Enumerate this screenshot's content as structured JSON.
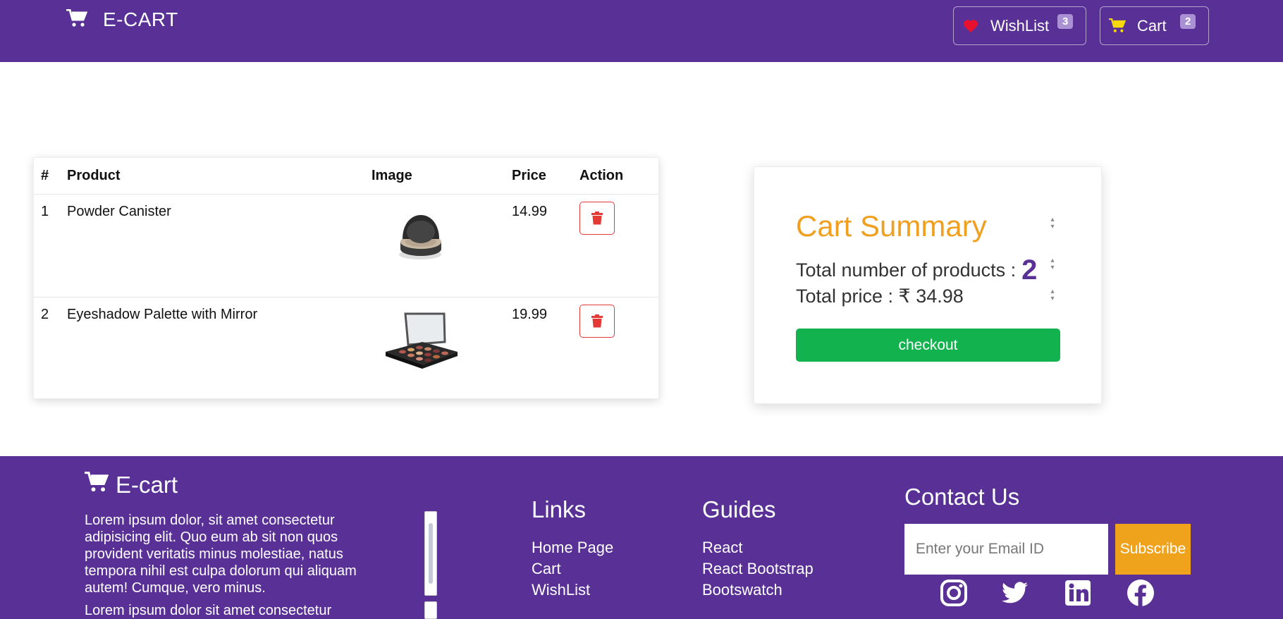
{
  "navbar": {
    "brand": "E-CART",
    "brand_icon": "cart-icon",
    "wishlist": {
      "label": "WishList",
      "count": "3",
      "icon": "heart-icon",
      "icon_color": "#e8112d"
    },
    "cart": {
      "label": "Cart",
      "count": "2",
      "icon": "cart-icon",
      "icon_color": "#f5d90a"
    },
    "background": "#593196"
  },
  "cart_table": {
    "headers": [
      "#",
      "Product",
      "Image",
      "Price",
      "Action"
    ],
    "rows": [
      {
        "index": "1",
        "product": "Powder Canister",
        "image": "powder-canister-image",
        "price": "14.99",
        "action_icon": "trash-icon"
      },
      {
        "index": "2",
        "product": "Eyeshadow Palette with Mirror",
        "image": "eyeshadow-palette-image",
        "price": "19.99",
        "action_icon": "trash-icon"
      }
    ]
  },
  "summary": {
    "title": "Cart Summary",
    "count_label": "Total number of products :",
    "count_value": "2",
    "price_label": "Total price : ₹ 34.98",
    "checkout_label": "checkout",
    "title_color": "#f0a020",
    "checkout_color": "#12b24f"
  },
  "footer": {
    "brand": "E-cart",
    "description": "Lorem ipsum dolor, sit amet consectetur adipisicing elit. Quo eum ab sit non quos provident veritatis minus molestiae, natus tempora nihil est culpa dolorum qui aliquam autem! Cumque, vero minus.",
    "description2": "Lorem ipsum dolor sit amet consectetur",
    "links": {
      "title": "Links",
      "items": [
        "Home Page",
        "Cart",
        "WishList"
      ]
    },
    "guides": {
      "title": "Guides",
      "items": [
        "React",
        "React Bootstrap",
        "Bootswatch"
      ]
    },
    "contact": {
      "title": "Contact Us",
      "email_placeholder": "Enter your Email ID",
      "subscribe_label": "Subscribe",
      "subscribe_color": "#efa31d"
    },
    "social": [
      "instagram-icon",
      "twitter-icon",
      "linkedin-icon",
      "facebook-icon"
    ]
  }
}
